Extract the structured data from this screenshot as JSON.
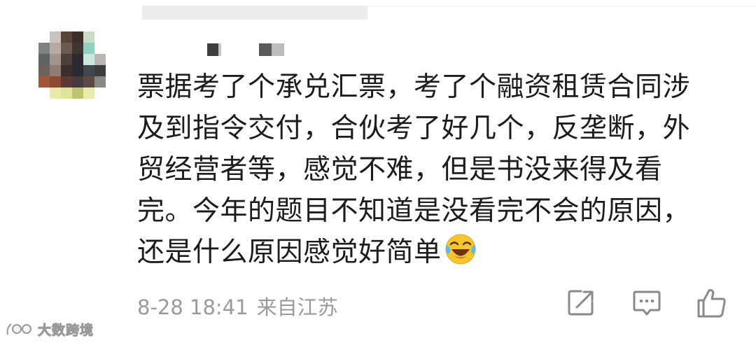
{
  "comment": {
    "lines": [
      "票据考了个承兑汇票，考了个融资租赁合同涉",
      "及到指令交付，合伙考了好几个，反垄断，外",
      "贸经营者等，感觉不难，但是书没来得及看",
      "完。今年的题目不知道是没看完不会的原因，",
      "还是什么原因感觉好简单"
    ],
    "emoji": "laughing-with-tears"
  },
  "meta": {
    "timestamp": "8-28 18:41",
    "location": "来自江苏"
  },
  "actions": {
    "share_icon": "share-icon",
    "comment_icon": "comment-icon",
    "like_icon": "thumbs-up-icon"
  },
  "watermark": {
    "text": "大数跨境"
  },
  "colors": {
    "text": "#1c1c1c",
    "meta": "#9a9a9a",
    "icon": "#8a8a8a",
    "emoji_face": "#f7c52e"
  }
}
